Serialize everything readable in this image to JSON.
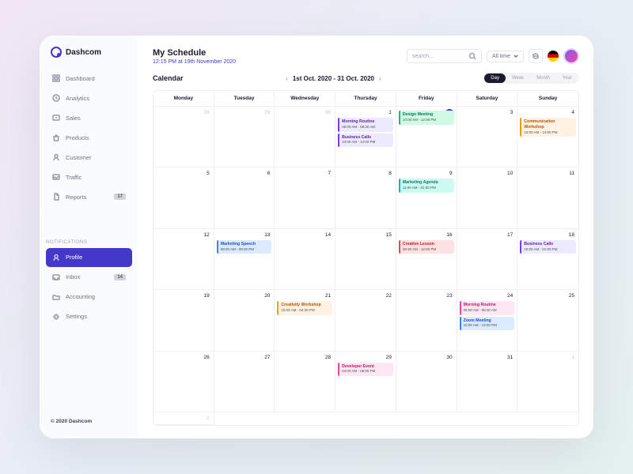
{
  "brand": "Dashcom",
  "nav": {
    "items": [
      {
        "label": "Dashboard",
        "icon": "grid"
      },
      {
        "label": "Analytics",
        "icon": "clock"
      },
      {
        "label": "Sales",
        "icon": "dollar"
      },
      {
        "label": "Products",
        "icon": "bag"
      },
      {
        "label": "Customer",
        "icon": "user"
      },
      {
        "label": "Traffic",
        "icon": "image"
      },
      {
        "label": "Reports",
        "icon": "file",
        "badge": "17"
      }
    ],
    "section": "NOTIFICATIONS",
    "items2": [
      {
        "label": "Profile",
        "icon": "user",
        "active": true
      },
      {
        "label": "Inbox",
        "icon": "inbox",
        "badge": "14"
      },
      {
        "label": "Accounting",
        "icon": "folder"
      },
      {
        "label": "Settings",
        "icon": "gear"
      }
    ]
  },
  "footer": "© 2020 Dashcom",
  "header": {
    "title": "My Schedule",
    "timestamp": "12:15 PM at 19th November 2020",
    "search_placeholder": "search...",
    "filter": "All time"
  },
  "calendar": {
    "title": "Calendar",
    "range": "1st Oct. 2020 - 31 Oct. 2020",
    "views": [
      "Day",
      "Week",
      "Month",
      "Year"
    ],
    "active_view": "Day",
    "dow": [
      "Monday",
      "Tuesday",
      "Wednesday",
      "Thursday",
      "Friday",
      "Saturday",
      "Sunday"
    ],
    "cells": [
      {
        "n": 28,
        "muted": true
      },
      {
        "n": 29,
        "muted": true
      },
      {
        "n": 30,
        "muted": true
      },
      {
        "n": 1,
        "events": [
          {
            "title": "Morning Routine",
            "time": "06:00 AM - 08:30 AM",
            "c": "purple"
          },
          {
            "title": "Business Calls",
            "time": "10:00 AM - 13:00 PM",
            "c": "purple"
          }
        ]
      },
      {
        "n": 2,
        "today": true,
        "events": [
          {
            "title": "Design Meeting",
            "time": "10:00 AM - 12:00 PM",
            "c": "green"
          }
        ]
      },
      {
        "n": 3
      },
      {
        "n": 4,
        "events": [
          {
            "title": "Communication Workshop",
            "time": "10:00 AM - 14:00 PM",
            "c": "orange"
          }
        ]
      },
      {
        "n": 5
      },
      {
        "n": 6
      },
      {
        "n": 7
      },
      {
        "n": 8
      },
      {
        "n": 9,
        "events": [
          {
            "title": "Marketing Agenda",
            "time": "11:00 AM - 01:00 PM",
            "c": "teal"
          }
        ]
      },
      {
        "n": 10
      },
      {
        "n": 11
      },
      {
        "n": 12
      },
      {
        "n": 13,
        "events": [
          {
            "title": "Marketing Speech",
            "time": "08:00 AM - 08:30 PM",
            "c": "blue"
          }
        ]
      },
      {
        "n": 14
      },
      {
        "n": 15
      },
      {
        "n": 16,
        "events": [
          {
            "title": "Creative Lesson",
            "time": "08:30 AM - 12:00 PM",
            "c": "red"
          }
        ]
      },
      {
        "n": 17
      },
      {
        "n": 18,
        "events": [
          {
            "title": "Business Calls",
            "time": "10:00 AM - 01:00 PM",
            "c": "purple"
          }
        ]
      },
      {
        "n": 19
      },
      {
        "n": 20
      },
      {
        "n": 21,
        "events": [
          {
            "title": "Creativity Workshop",
            "time": "10:00 AM - 04:30 PM",
            "c": "orange"
          }
        ]
      },
      {
        "n": 22
      },
      {
        "n": 23
      },
      {
        "n": 24,
        "events": [
          {
            "title": "Morning Routine",
            "time": "06:00 AM - 08:30 AM",
            "c": "pink"
          },
          {
            "title": "Zoom Meeting",
            "time": "10:00 AM - 13:00 PM",
            "c": "blue"
          }
        ]
      },
      {
        "n": 25
      },
      {
        "n": 26
      },
      {
        "n": 27
      },
      {
        "n": 28
      },
      {
        "n": 29,
        "events": [
          {
            "title": "Developer Event",
            "time": "04:00 AM - 08:00 PM",
            "c": "pink"
          }
        ]
      },
      {
        "n": 30
      },
      {
        "n": 31
      },
      {
        "n": 1,
        "muted": true
      },
      {
        "n": 2,
        "muted": true
      }
    ]
  }
}
